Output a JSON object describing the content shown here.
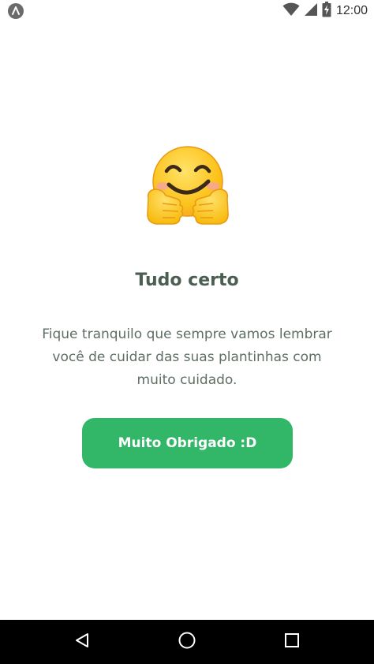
{
  "status_bar": {
    "time": "12:00",
    "app_icon": "app-launcher-icon",
    "icons": [
      "wifi-icon",
      "cell-signal-icon",
      "battery-charging-icon"
    ]
  },
  "main": {
    "emoji": "hugging-face-emoji",
    "title": "Tudo certo",
    "message": "Fique tranquilo que sempre vamos lembrar você de cuidar das suas plantinhas com muito cuidado.",
    "button_label": "Muito Obrigado :D"
  },
  "nav_bar": {
    "icons": [
      "back-icon",
      "home-icon",
      "recents-icon"
    ]
  },
  "colors": {
    "accent": "#32b768",
    "title": "#4b5e51",
    "text": "#5e6e63",
    "nav_background": "#000000"
  }
}
